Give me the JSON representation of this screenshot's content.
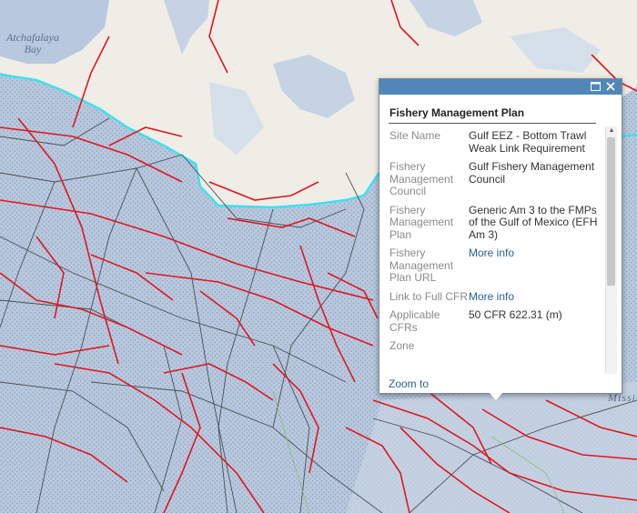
{
  "map": {
    "labels": {
      "bay": "Atchafalaya\nBay",
      "river_fragment": "Missis"
    },
    "colors": {
      "water": "#b8c8de",
      "land": "#f0eee8",
      "coastline": "#3ee0f0",
      "regulation_lines": "#e0161e",
      "pipeline_lines": "#4a4e52"
    }
  },
  "popup": {
    "title": "Fishery Management Plan",
    "maximize_icon": "maximize-icon",
    "close_icon": "close-icon",
    "attributes": [
      {
        "label": "Site Name",
        "value": "Gulf EEZ - Bottom Trawl Weak Link Requirement"
      },
      {
        "label": "Fishery Management Council",
        "value": "Gulf Fishery Management Council"
      },
      {
        "label": "Fishery Management Plan",
        "value": "Generic Am 3 to the FMPs of the Gulf of Mexico (EFH Am 3)"
      },
      {
        "label": "Fishery Management Plan URL",
        "value": "More info"
      },
      {
        "label": "Link to Full CFR",
        "value": "More info"
      },
      {
        "label": "Applicable CFRs",
        "value": "50 CFR 622.31 (m)"
      },
      {
        "label": "Zone",
        "value": ""
      }
    ],
    "zoom_link": "Zoom to"
  }
}
